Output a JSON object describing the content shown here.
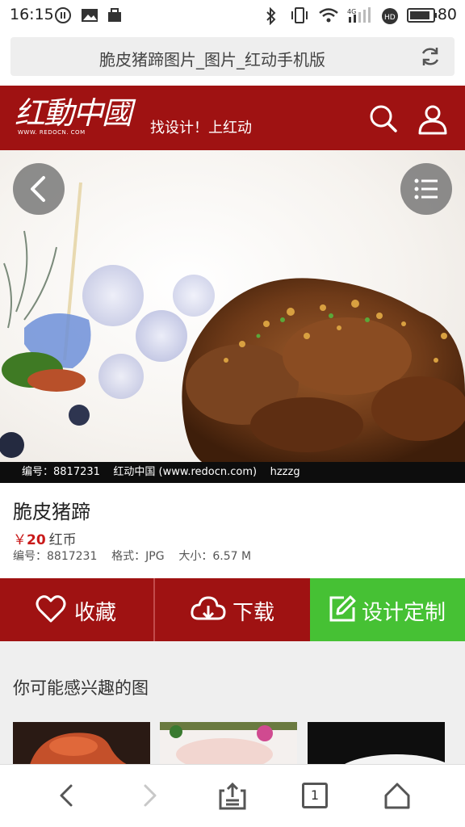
{
  "status_bar": {
    "time": "16:15",
    "battery": "80",
    "network": "4G"
  },
  "browser": {
    "page_title": "脆皮猪蹄图片_图片_红动手机版"
  },
  "site_header": {
    "logo_text": "红動中國",
    "logo_domain": "WWW. REDOCN. COM",
    "slogan": "找设计！上红动",
    "bg_color": "#9f1212"
  },
  "hero": {
    "caption": "编号：8817231    红动中国 (www.redocn.com)    hzzzg"
  },
  "product": {
    "name": "脆皮猪蹄",
    "price_symbol": "￥",
    "price": "20",
    "price_unit": "红币",
    "meta": "编号：8817231    格式：JPG    大小：6.57 M"
  },
  "actions": {
    "favorite": "收藏",
    "download": "下载",
    "custom": "设计定制",
    "custom_color": "#46c134"
  },
  "related": {
    "heading": "你可能感兴趣的图"
  },
  "bottom_nav": {
    "tab_count": "1"
  }
}
